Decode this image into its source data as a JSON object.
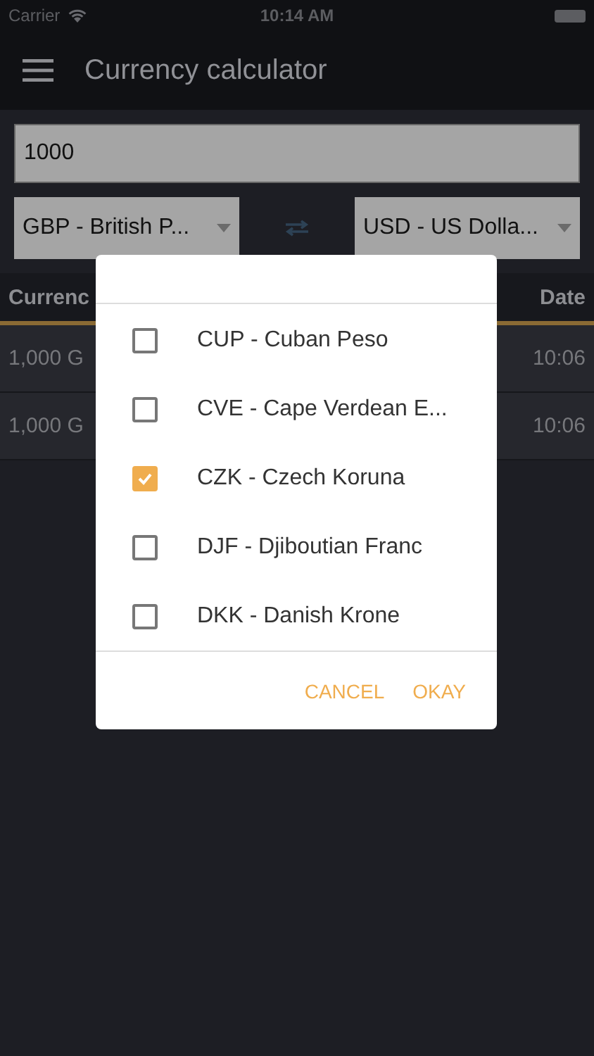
{
  "status_bar": {
    "carrier": "Carrier",
    "time": "10:14 AM"
  },
  "header": {
    "title": "Currency calculator"
  },
  "amount": {
    "value": "1000"
  },
  "from_select": {
    "value": "GBP - British P..."
  },
  "to_select": {
    "value": "USD - US Dolla..."
  },
  "table": {
    "columns": [
      "Currenc",
      "Date"
    ],
    "rows": [
      {
        "column_1": "1,000 G",
        "date": "10:06"
      },
      {
        "column_1": "1,000 G",
        "date": "10:06"
      }
    ]
  },
  "dialog": {
    "items": [
      {
        "label": "CUP - Cuban Peso",
        "checked": false
      },
      {
        "label": "CVE - Cape Verdean E...",
        "checked": false
      },
      {
        "label": "CZK - Czech Koruna",
        "checked": true
      },
      {
        "label": "DJF - Djiboutian Franc",
        "checked": false
      },
      {
        "label": "DKK - Danish Krone",
        "checked": false
      }
    ],
    "buttons": [
      "CANCEL",
      "OKAY"
    ]
  }
}
